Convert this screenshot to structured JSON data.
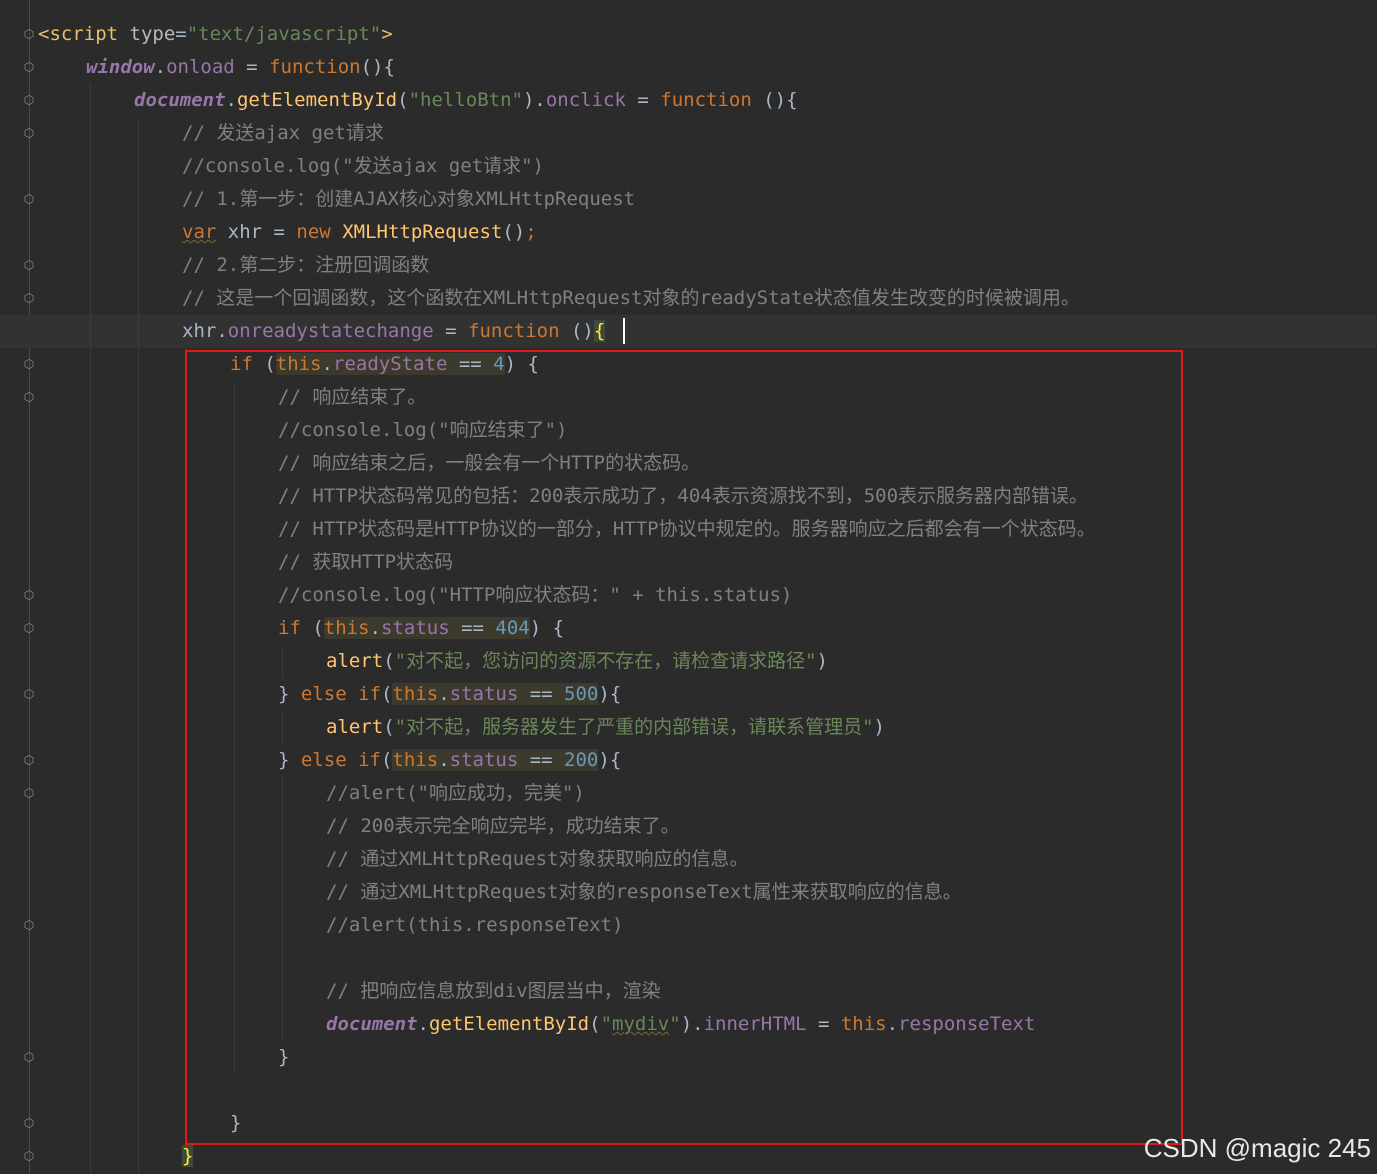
{
  "editor": {
    "lines": [
      {
        "indent": 0,
        "tokens": [
          [
            "tag",
            "<script "
          ],
          [
            "attr",
            "type"
          ],
          [
            "plain",
            "="
          ],
          [
            "str",
            "\"text/javascript\""
          ],
          [
            "tag",
            ">"
          ]
        ]
      },
      {
        "indent": 1,
        "tokens": [
          [
            "obj",
            "window"
          ],
          [
            "plain",
            "."
          ],
          [
            "prop",
            "onload"
          ],
          [
            "plain",
            " = "
          ],
          [
            "kw",
            "function"
          ],
          [
            "plain",
            "(){"
          ]
        ]
      },
      {
        "indent": 2,
        "tokens": [
          [
            "obj",
            "document"
          ],
          [
            "plain",
            "."
          ],
          [
            "fn",
            "getElementById"
          ],
          [
            "plain",
            "("
          ],
          [
            "str",
            "\"helloBtn\""
          ],
          [
            "plain",
            ")."
          ],
          [
            "prop",
            "onclick"
          ],
          [
            "plain",
            " = "
          ],
          [
            "kw",
            "function"
          ],
          [
            "plain",
            " (){"
          ]
        ]
      },
      {
        "indent": 3,
        "tokens": [
          [
            "cmt",
            "// 发送ajax get请求"
          ]
        ]
      },
      {
        "indent": 3,
        "tokens": [
          [
            "cmt",
            "//console.log(\"发送ajax get请求\")"
          ]
        ]
      },
      {
        "indent": 3,
        "tokens": [
          [
            "cmt",
            "// 1.第一步：创建AJAX核心对象XMLHttpRequest"
          ]
        ]
      },
      {
        "indent": 3,
        "tokens": [
          [
            "kwsq",
            "var"
          ],
          [
            "plain",
            " xhr = "
          ],
          [
            "kw",
            "new"
          ],
          [
            "plain",
            " "
          ],
          [
            "fn",
            "XMLHttpRequest"
          ],
          [
            "plain",
            "()"
          ],
          [
            "kw",
            ";"
          ]
        ]
      },
      {
        "indent": 3,
        "tokens": [
          [
            "cmt",
            "// 2.第二步：注册回调函数"
          ]
        ]
      },
      {
        "indent": 3,
        "tokens": [
          [
            "cmt",
            "// 这是一个回调函数，这个函数在XMLHttpRequest对象的readyState状态值发生改变的时候被调用。"
          ]
        ]
      },
      {
        "indent": 3,
        "current": true,
        "tokens": [
          [
            "plain",
            "xhr."
          ],
          [
            "prop",
            "onreadystatechange"
          ],
          [
            "plain",
            " = "
          ],
          [
            "kw",
            "function"
          ],
          [
            "plain",
            " ()"
          ],
          [
            "brace",
            "{"
          ]
        ]
      },
      {
        "indent": 4,
        "tokens": [
          [
            "kw",
            "if"
          ],
          [
            "plain",
            " ("
          ],
          [
            "hlkw",
            "this"
          ],
          [
            "hlplain",
            "."
          ],
          [
            "hlprop",
            "readyState"
          ],
          [
            "hlplain",
            " == "
          ],
          [
            "hlnum",
            "4"
          ],
          [
            "plain",
            ") {"
          ]
        ]
      },
      {
        "indent": 5,
        "tokens": [
          [
            "cmt",
            "// 响应结束了。"
          ]
        ]
      },
      {
        "indent": 5,
        "tokens": [
          [
            "cmt",
            "//console.log(\"响应结束了\")"
          ]
        ]
      },
      {
        "indent": 5,
        "tokens": [
          [
            "cmt",
            "// 响应结束之后，一般会有一个HTTP的状态码。"
          ]
        ]
      },
      {
        "indent": 5,
        "tokens": [
          [
            "cmt",
            "// HTTP状态码常见的包括：200表示成功了，404表示资源找不到，500表示服务器内部错误。"
          ]
        ]
      },
      {
        "indent": 5,
        "tokens": [
          [
            "cmt",
            "// HTTP状态码是HTTP协议的一部分，HTTP协议中规定的。服务器响应之后都会有一个状态码。"
          ]
        ]
      },
      {
        "indent": 5,
        "tokens": [
          [
            "cmt",
            "// 获取HTTP状态码"
          ]
        ]
      },
      {
        "indent": 5,
        "tokens": [
          [
            "cmt",
            "//console.log(\"HTTP响应状态码：\" + this.status)"
          ]
        ]
      },
      {
        "indent": 5,
        "tokens": [
          [
            "kw",
            "if"
          ],
          [
            "plain",
            " ("
          ],
          [
            "hlkw",
            "this"
          ],
          [
            "hlplain",
            "."
          ],
          [
            "hlprop",
            "status"
          ],
          [
            "hlplain",
            " == "
          ],
          [
            "hlnum",
            "404"
          ],
          [
            "plain",
            ") {"
          ]
        ]
      },
      {
        "indent": 6,
        "tokens": [
          [
            "fn",
            "alert"
          ],
          [
            "plain",
            "("
          ],
          [
            "str",
            "\"对不起，您访问的资源不存在，请检查请求路径\""
          ],
          [
            "plain",
            ")"
          ]
        ]
      },
      {
        "indent": 5,
        "tokens": [
          [
            "plain",
            "} "
          ],
          [
            "kw",
            "else if"
          ],
          [
            "plain",
            "("
          ],
          [
            "hlkw",
            "this"
          ],
          [
            "hlplain",
            "."
          ],
          [
            "hlprop",
            "status"
          ],
          [
            "hlplain",
            " == "
          ],
          [
            "hlnum",
            "500"
          ],
          [
            "plain",
            "){"
          ]
        ]
      },
      {
        "indent": 6,
        "tokens": [
          [
            "fn",
            "alert"
          ],
          [
            "plain",
            "("
          ],
          [
            "str",
            "\"对不起，服务器发生了严重的内部错误，请联系管理员\""
          ],
          [
            "plain",
            ")"
          ]
        ]
      },
      {
        "indent": 5,
        "tokens": [
          [
            "plain",
            "} "
          ],
          [
            "kw",
            "else if"
          ],
          [
            "plain",
            "("
          ],
          [
            "hlkw",
            "this"
          ],
          [
            "hlplain",
            "."
          ],
          [
            "hlprop",
            "status"
          ],
          [
            "hlplain",
            " == "
          ],
          [
            "hlnum",
            "200"
          ],
          [
            "plain",
            "){"
          ]
        ]
      },
      {
        "indent": 6,
        "tokens": [
          [
            "cmt",
            "//alert(\"响应成功，完美\")"
          ]
        ]
      },
      {
        "indent": 6,
        "tokens": [
          [
            "cmt",
            "// 200表示完全响应完毕，成功结束了。"
          ]
        ]
      },
      {
        "indent": 6,
        "tokens": [
          [
            "cmt",
            "// 通过XMLHttpRequest对象获取响应的信息。"
          ]
        ]
      },
      {
        "indent": 6,
        "tokens": [
          [
            "cmt",
            "// 通过XMLHttpRequest对象的responseText属性来获取响应的信息。"
          ]
        ]
      },
      {
        "indent": 6,
        "tokens": [
          [
            "cmt",
            "//alert(this.responseText)"
          ]
        ]
      },
      {
        "indent": 6,
        "tokens": []
      },
      {
        "indent": 6,
        "tokens": [
          [
            "cmt",
            "// 把响应信息放到div图层当中，渲染"
          ]
        ]
      },
      {
        "indent": 6,
        "tokens": [
          [
            "obj",
            "document"
          ],
          [
            "plain",
            "."
          ],
          [
            "fn",
            "getElementById"
          ],
          [
            "plain",
            "("
          ],
          [
            "str",
            "\""
          ],
          [
            "strsq",
            "mydiv"
          ],
          [
            "str",
            "\""
          ],
          [
            "plain",
            ")."
          ],
          [
            "prop",
            "innerHTML"
          ],
          [
            "plain",
            " = "
          ],
          [
            "kw",
            "this"
          ],
          [
            "plain",
            "."
          ],
          [
            "prop",
            "responseText"
          ]
        ]
      },
      {
        "indent": 5,
        "tokens": [
          [
            "plain",
            "}"
          ]
        ]
      },
      {
        "indent": 4,
        "tokens": []
      },
      {
        "indent": 4,
        "tokens": [
          [
            "plain",
            "}"
          ]
        ]
      },
      {
        "indent": 3,
        "tokens": [
          [
            "brace",
            "}"
          ]
        ]
      }
    ]
  },
  "watermark": "CSDN @magic 245",
  "colors": {
    "background": "#2b2b2b",
    "keyword": "#cc7832",
    "string": "#6a8759",
    "comment": "#808080",
    "highlight_box": "#e01818"
  }
}
